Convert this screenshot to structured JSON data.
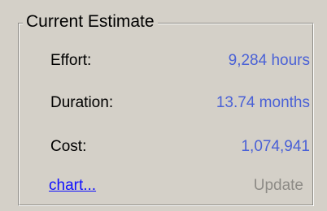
{
  "current_estimate": {
    "title": "Current Estimate",
    "rows": [
      {
        "label": "Effort:",
        "value": "9,284 hours"
      },
      {
        "label": "Duration:",
        "value": "13.74 months"
      },
      {
        "label": "Cost:",
        "value": "1,074,941"
      }
    ],
    "chart_link": "chart...",
    "update_label": "Update"
  },
  "colors": {
    "panel_bg": "#d4d0c8",
    "value_text": "#4a61d6",
    "link_text": "#1010ff",
    "disabled_text": "#8d8b86"
  }
}
